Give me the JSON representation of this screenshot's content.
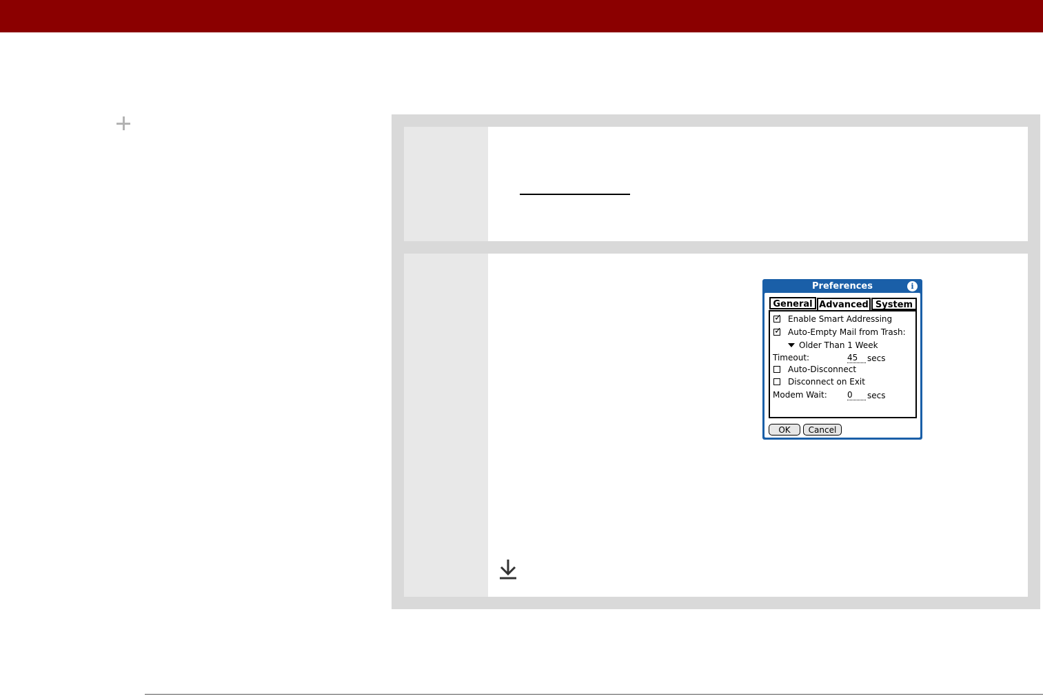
{
  "colors": {
    "header_bar": "#8b0000",
    "outer_frame": "#d9d9d9",
    "step_number_column": "#e8e8e8",
    "dialog_blue": "#1a5fa8"
  },
  "icons": {
    "tip": "plus-icon",
    "continued": "download-arrow-icon",
    "dialog_info": "info-icon"
  },
  "dialog": {
    "title": "Preferences",
    "info_glyph": "i",
    "tabs": [
      {
        "label": "General",
        "selected": false
      },
      {
        "label": "Advanced",
        "selected": true
      },
      {
        "label": "System",
        "selected": false
      }
    ],
    "options": {
      "smart_addressing": {
        "label": "Enable Smart Addressing",
        "checked": true
      },
      "auto_empty": {
        "label": "Auto-Empty Mail from Trash:",
        "checked": true
      },
      "auto_empty_period": "Older Than 1 Week",
      "timeout_label": "Timeout:",
      "timeout_value": "45",
      "timeout_unit": "secs",
      "auto_disconnect": {
        "label": "Auto-Disconnect",
        "checked": false
      },
      "disconnect_exit": {
        "label": "Disconnect on Exit",
        "checked": false
      },
      "modem_wait_label": "Modem Wait:",
      "modem_wait_value": "0",
      "modem_wait_unit": "secs"
    },
    "buttons": {
      "ok": "OK",
      "cancel": "Cancel"
    }
  }
}
